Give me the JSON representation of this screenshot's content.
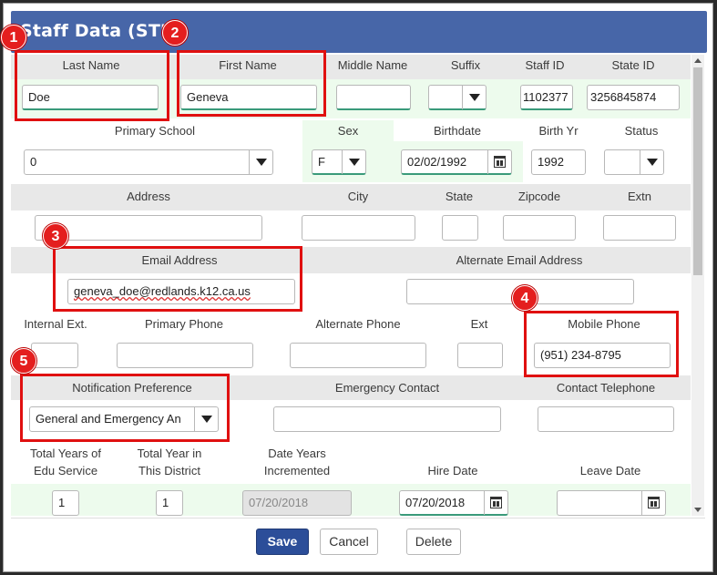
{
  "window": {
    "title": "Staff Data (STF)"
  },
  "badges": [
    "1",
    "2",
    "3",
    "4",
    "5"
  ],
  "labels": {
    "last_name": "Last Name",
    "first_name": "First Name",
    "middle_name": "Middle Name",
    "suffix": "Suffix",
    "staff_id": "Staff ID",
    "state_id": "State ID",
    "primary_school": "Primary School",
    "sex": "Sex",
    "birthdate": "Birthdate",
    "birth_yr": "Birth Yr",
    "status": "Status",
    "address": "Address",
    "city": "City",
    "state": "State",
    "zipcode": "Zipcode",
    "extn": "Extn",
    "email": "Email Address",
    "alt_email": "Alternate Email Address",
    "internal_ext": "Internal Ext.",
    "primary_phone": "Primary Phone",
    "alternate_phone": "Alternate Phone",
    "ext": "Ext",
    "mobile_phone": "Mobile Phone",
    "notification_pref": "Notification Preference",
    "emergency_contact": "Emergency Contact",
    "contact_telephone": "Contact Telephone",
    "total_years_edu_1": "Total Years of",
    "total_years_edu_2": "Edu Service",
    "total_year_district_1": "Total Year in",
    "total_year_district_2": "This District",
    "date_years_incr_1": "Date Years",
    "date_years_incr_2": "Incremented",
    "hire_date": "Hire Date",
    "leave_date": "Leave Date"
  },
  "values": {
    "last_name": "Doe",
    "first_name": "Geneva",
    "middle_name": "",
    "suffix": "",
    "staff_id": "1102377",
    "state_id": "3256845874",
    "primary_school": "0",
    "sex": "F",
    "birthdate": "02/02/1992",
    "birth_yr": "1992",
    "status": "",
    "email": "geneva_doe@redlands.k12.ca.us",
    "mobile_phone": "(951) 234-8795",
    "notification_pref": "General and Emergency An",
    "total_years_edu": "1",
    "total_year_district": "1",
    "date_years_incr": "07/20/2018",
    "hire_date": "07/20/2018",
    "leave_date": ""
  },
  "buttons": {
    "save": "Save",
    "cancel": "Cancel",
    "delete": "Delete"
  },
  "colors": {
    "title_bar": "#4766a8",
    "highlight": "#e01010",
    "primary_button": "#2c4e99",
    "required_underline": "#3a9a7a"
  }
}
